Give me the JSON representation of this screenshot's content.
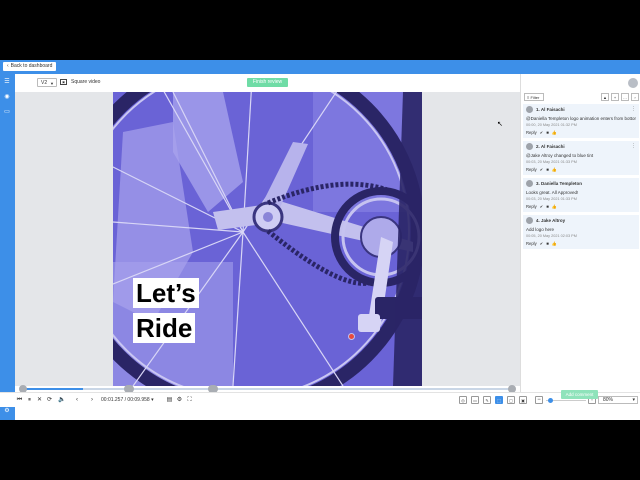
{
  "topbar": {
    "back_label": "Back to dashboard",
    "back_icon": "chevron-left-icon"
  },
  "rail": {
    "icons": [
      "menu-icon",
      "eye-icon",
      "folder-icon"
    ],
    "bottom_icon": "settings-icon"
  },
  "toolbar": {
    "version": "V2",
    "format_label": "Square video",
    "finish_label": "Finish review"
  },
  "video": {
    "line1": "Let’s",
    "line2": "Ride"
  },
  "timeline": {
    "markers": [
      "",
      "",
      "",
      "",
      "",
      ""
    ],
    "progress": 0.12
  },
  "player": {
    "current_time": "00:01.257",
    "separator": "/",
    "total_time": "00:09.958"
  },
  "zoom": {
    "value": "80%",
    "level": 0.05
  },
  "panel": {
    "filter_label": "Filter",
    "comments": [
      {
        "num": "1.",
        "author": "Al Faisachi",
        "text": "@Daniella Templeton logo animation enters from bottom…",
        "time": "00:00, 20 May 2021 01:32 PM",
        "reply": "Reply"
      },
      {
        "num": "2.",
        "author": "Al Faisachi",
        "text": "@Jake Altroy changed to blue tint",
        "time": "00:03, 20 May 2021 01:33 PM",
        "reply": "Reply"
      },
      {
        "num": "3.",
        "author": "Daniella Templeton",
        "text": "Looks great. All Approved!",
        "time": "00:03, 20 May 2021 01:33 PM",
        "reply": "Reply"
      },
      {
        "num": "4.",
        "author": "Jake Altroy",
        "text": "Add logo here",
        "time": "00:05, 20 May 2021 02:03 PM",
        "reply": "Reply"
      }
    ],
    "add_comment_label": "Add comment"
  },
  "colors": {
    "accent": "#3d8fe8",
    "finish": "#6fdca6",
    "video_tint": "#6a63d6"
  }
}
